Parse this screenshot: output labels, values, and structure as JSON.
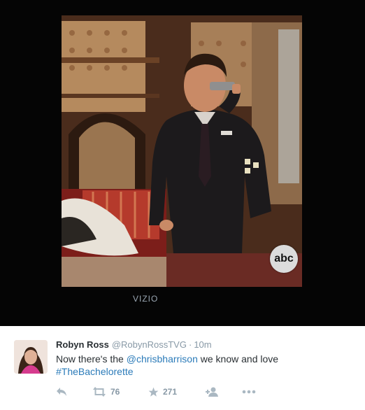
{
  "photo": {
    "tv_brand": "VIZIO",
    "network_logo": "abc"
  },
  "tweet": {
    "display_name": "Robyn Ross",
    "handle": "@RobynRossTVG",
    "separator": "·",
    "time": "10m",
    "text_before": "Now there's the ",
    "mention": "@chrisbharrison",
    "text_after": " we know and love",
    "hashtag": "#TheBachelorette",
    "retweets": "76",
    "favorites": "271"
  },
  "icons": {
    "reply": "reply-icon",
    "retweet": "retweet-icon",
    "favorite": "star-icon",
    "follow": "follow-icon",
    "more": "more-icon"
  },
  "colors": {
    "link": "#2b7bb9",
    "name": "#292f33",
    "muted": "#8899a6",
    "action_icon": "#aab8c2"
  }
}
